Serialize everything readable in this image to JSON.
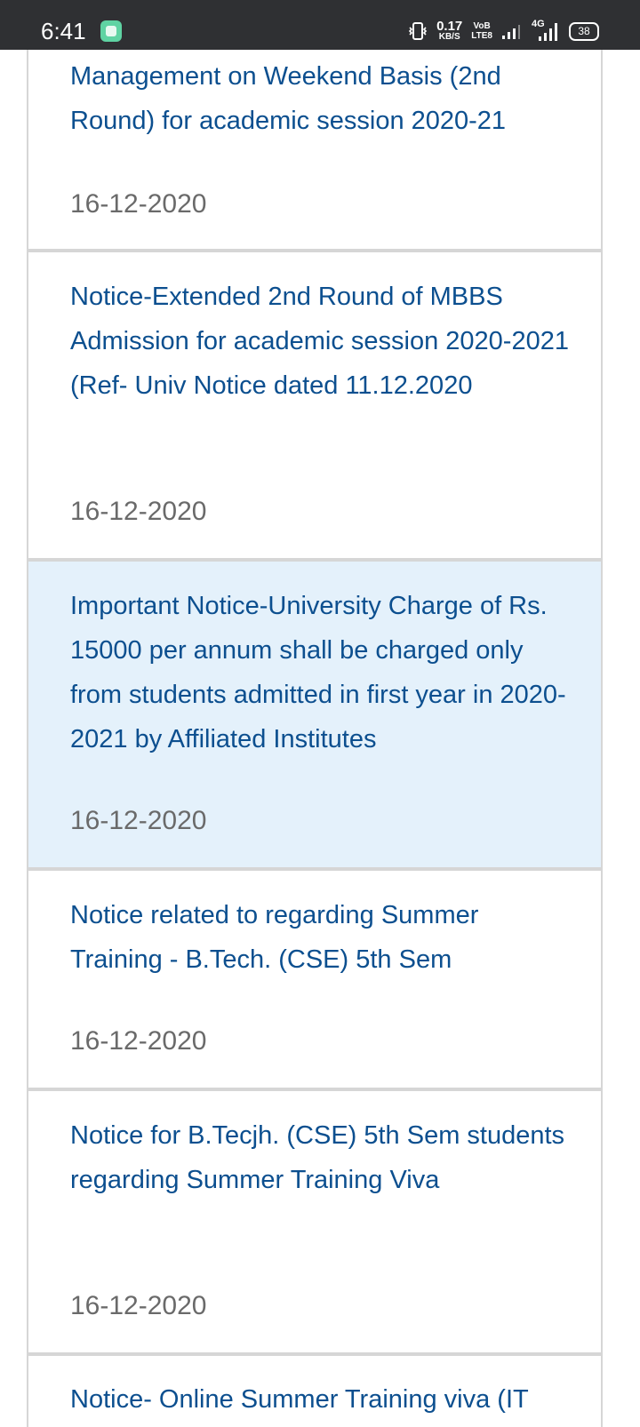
{
  "status_bar": {
    "time": "6:41",
    "net_speed_value": "0.17",
    "net_speed_unit": "KB/S",
    "volte_top": "VoB",
    "volte_bottom": "LTE8",
    "network_type": "4G",
    "battery": "38"
  },
  "notices": [
    {
      "title": "Management on Weekend Basis (2nd Round) for academic session 2020-21",
      "date": "16-12-2020",
      "highlighted": false
    },
    {
      "title": "Notice-Extended 2nd Round of MBBS Admission for academic session 2020-2021 (Ref- Univ Notice dated 11.12.2020",
      "date": "16-12-2020",
      "highlighted": false
    },
    {
      "title": "Important Notice-University Charge of Rs. 15000 per annum shall be charged only from students admitted in first year in 2020-2021 by Affiliated Institutes",
      "date": "16-12-2020",
      "highlighted": true
    },
    {
      "title": "Notice related to regarding Summer Training - B.Tech. (CSE) 5th Sem",
      "date": "16-12-2020",
      "highlighted": false
    },
    {
      "title": "Notice for B.Tecjh. (CSE) 5th Sem students regarding Summer Training Viva",
      "date": "16-12-2020",
      "highlighted": false
    },
    {
      "title": "Notice- Online Summer Training viva (IT",
      "date": "",
      "highlighted": false
    }
  ]
}
